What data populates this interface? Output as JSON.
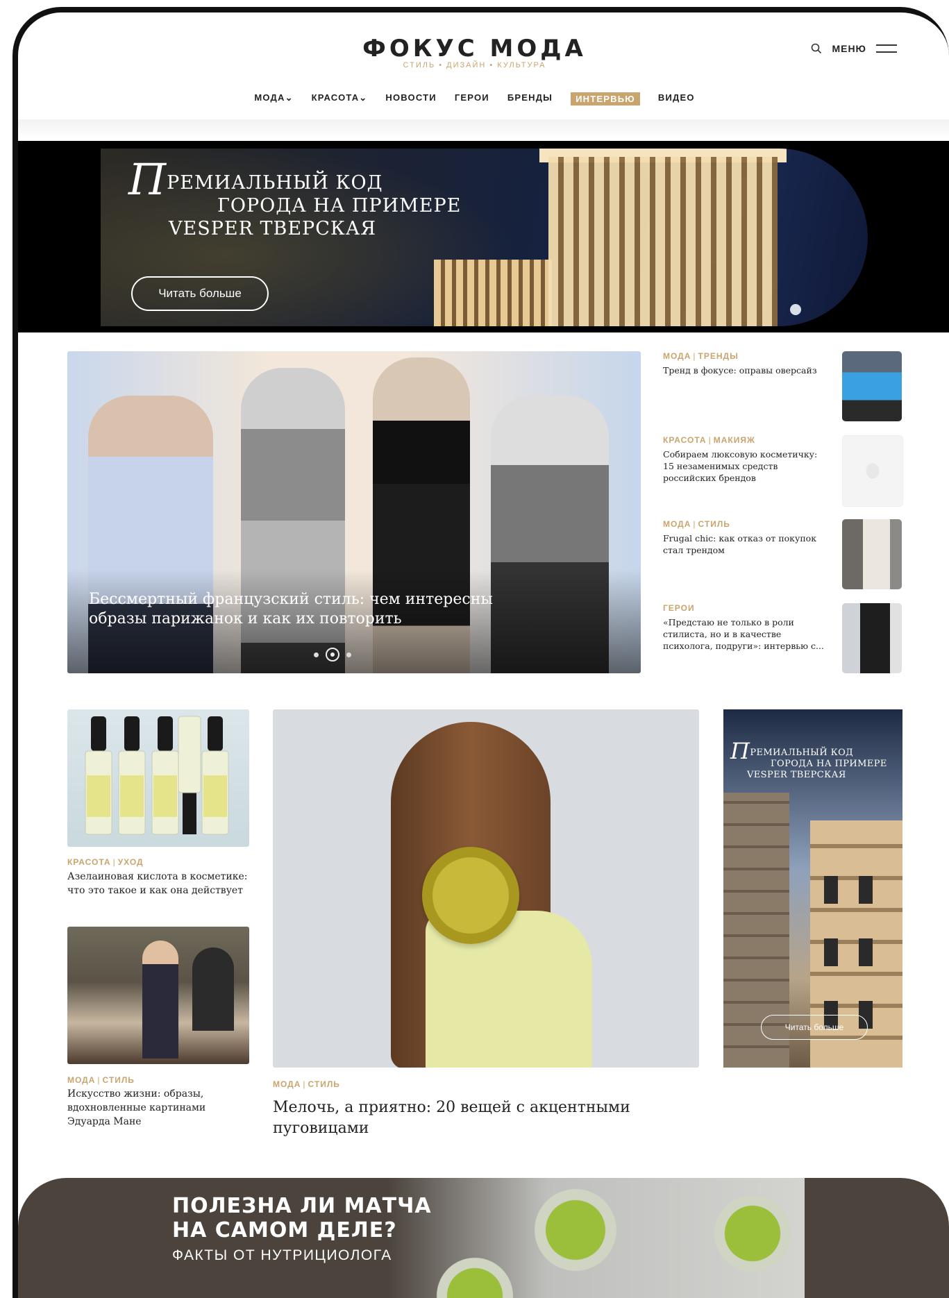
{
  "header": {
    "logo": "ФОКУС МОДА",
    "tagline": "СТИЛЬ • ДИЗАЙН • КУЛЬТУРА",
    "menu_label": "МЕНЮ",
    "search_icon": "search-icon",
    "menu_icon": "hamburger-icon"
  },
  "nav": {
    "items": [
      "МОДА⌄",
      "КРАСОТА⌄",
      "НОВОСТИ",
      "ГЕРОИ",
      "БРЕНДЫ",
      "ИНТЕРВЬЮ",
      "ВИДЕО"
    ],
    "active": "ИНТЕРВЬЮ"
  },
  "banner": {
    "cap": "П",
    "line1": "РЕМИАЛЬНЫЙ КОД",
    "line2": "ГОРОДА НА ПРИМЕРЕ",
    "line3": "VESPER ТВЕРСКАЯ",
    "button": "Читать больше"
  },
  "hero": {
    "title": "Бессмертный французский стиль: чем интересны образы парижанок и как их повторить"
  },
  "side_list": [
    {
      "cat1": "МОДА",
      "cat2": "ТРЕНДЫ",
      "title": "Тренд в фокусе: оправы оверсайз"
    },
    {
      "cat1": "КРАСОТА",
      "cat2": "МАКИЯЖ",
      "title": "Собираем люксовую косметичку: 15 незаменимых средств российских брендов"
    },
    {
      "cat1": "МОДА",
      "cat2": "СТИЛЬ",
      "title": "Frugal chic: как отказ от покупок стал трендом"
    },
    {
      "cat1": "ГЕРОИ",
      "cat2": "",
      "title": "«Предстаю не только в роли стилиста, но и в качестве психолога, подруги»: интервью с..."
    }
  ],
  "cards": {
    "serum": {
      "cat1": "КРАСОТА",
      "cat2": "УХОД",
      "title": "Азелаиновая кислота в косметике: что это такое и как она действует"
    },
    "manet": {
      "cat1": "МОДА",
      "cat2": "СТИЛЬ",
      "title": "Искусство жизни: образы, вдохновленные картинами Эдуарда Мане"
    },
    "button": {
      "cat1": "МОДА",
      "cat2": "СТИЛЬ",
      "title": "Мелочь, а приятно: 20 вещей с акцентными пуговицами"
    }
  },
  "tall_ad": {
    "cap": "П",
    "line1": "РЕМИАЛЬНЫЙ КОД",
    "line2": "ГОРОДА НА ПРИМЕРЕ",
    "line3": "VESPER ТВЕРСКАЯ",
    "button": "Читать больше"
  },
  "bottom_banner": {
    "line1": "ПОЛЕЗНА ЛИ МАТЧА",
    "line2": "НА САМОМ ДЕЛЕ?",
    "sub": "ФАКТЫ ОТ НУТРИЦИОЛОГА"
  },
  "colors": {
    "accent": "#c9a46e",
    "frame": "#111111",
    "bottom_bg": "#4b433c"
  }
}
